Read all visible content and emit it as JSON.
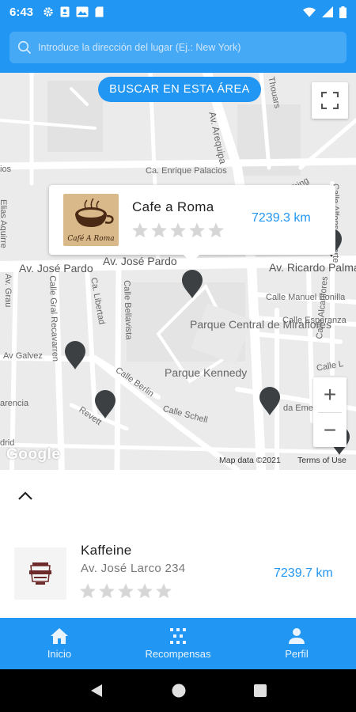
{
  "status_bar": {
    "time": "6:43"
  },
  "search": {
    "placeholder": "Introduce la dirección del lugar (Ej.: New York)"
  },
  "map": {
    "search_area_button": "BUSCAR EN ESTA ÁREA",
    "streets": {
      "av_arequipa": "Av. Arequipa",
      "thouars": "Thouars",
      "enrique_palacios": "Ca. Enrique Palacios",
      "washing": "Washing",
      "alfonso_ugarte": "Calle Alfonso Ugarte",
      "elias_aguirre": "Elias Aguirre",
      "av_jose_pardo_left": "Av. José Pardo",
      "av_jose_pardo_mid": "Av. José Pardo",
      "av_ricardo_palma": "Av. Ricardo Palma",
      "av_grau": "Av. Grau",
      "gral_recavarren": "Calle Gral Recavarren",
      "libertad": "Ca. Libertad",
      "bellavista": "Calle Bellavista",
      "manuel_bonilla": "Calle Manuel Bonilla",
      "esperanza": "Calle Esperanza",
      "alcanfores": "Calle Alcanfores",
      "galvez": "Av Galvez",
      "berlin": "Calle Berlin",
      "revett": "Revett",
      "schell": "Calle Schell",
      "lares": "Calle L",
      "varencia": "arencia",
      "da_emer": "da Emer",
      "drid": "drid",
      "ios": "ios"
    },
    "parks": {
      "central": "Parque Central de Miraflores",
      "kennedy": "Parque Kennedy"
    },
    "google_logo": "Google",
    "map_data": "Map data ©2021",
    "terms": "Terms of Use",
    "zoom_in": "+",
    "zoom_out": "−"
  },
  "info_card": {
    "name": "Cafe a Roma",
    "logo_text": "Café A Roma",
    "distance": "7239.3 km",
    "rating": 0
  },
  "list_item": {
    "name": "Kaffeine",
    "address": "Av. José Larco 234",
    "distance": "7239.7 km",
    "rating": 0
  },
  "bottom_nav": [
    {
      "label": "Inicio",
      "icon": "home-icon"
    },
    {
      "label": "Recompensas",
      "icon": "rewards-icon"
    },
    {
      "label": "Perfil",
      "icon": "person-icon"
    }
  ],
  "colors": {
    "primary": "#2196F3",
    "star": "#d6d6d6",
    "pin": "#3c4043"
  }
}
